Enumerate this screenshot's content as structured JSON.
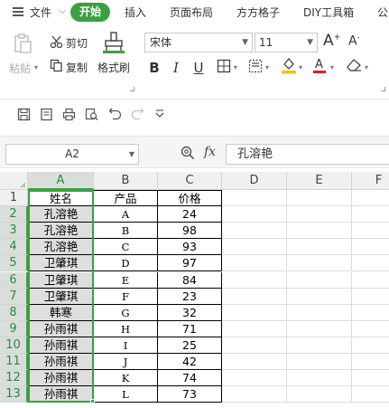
{
  "menu": {
    "items": [
      {
        "label": "文件"
      },
      {
        "label": "开始"
      },
      {
        "label": "插入"
      },
      {
        "label": "页面布局"
      },
      {
        "label": "方方格子"
      },
      {
        "label": "DIY工具箱"
      },
      {
        "label": "公"
      }
    ]
  },
  "ribbon": {
    "paste_label": "粘贴",
    "cut_label": "剪切",
    "copy_label": "复制",
    "format_painter_label": "格式刷",
    "font_name": "宋体",
    "font_size": "11",
    "font_color": "#e02020",
    "highlight_color": "#f3c300"
  },
  "formula_bar": {
    "name_box": "A2",
    "fx_label": "fx",
    "content": "孔溶艳"
  },
  "sheet": {
    "columns": [
      "A",
      "B",
      "C",
      "D",
      "E",
      "F"
    ],
    "rows": [
      "1",
      "2",
      "3",
      "4",
      "5",
      "6",
      "7",
      "8",
      "9",
      "10",
      "11",
      "12",
      "13"
    ],
    "selected_cell": "A2",
    "header": [
      "姓名",
      "产品",
      "价格"
    ],
    "data": [
      [
        "孔溶艳",
        "A",
        "24"
      ],
      [
        "孔溶艳",
        "B",
        "98"
      ],
      [
        "孔溶艳",
        "C",
        "93"
      ],
      [
        "卫肇琪",
        "D",
        "97"
      ],
      [
        "卫肇琪",
        "E",
        "84"
      ],
      [
        "卫肇琪",
        "F",
        "23"
      ],
      [
        "韩寒",
        "G",
        "32"
      ],
      [
        "孙雨祺",
        "H",
        "71"
      ],
      [
        "孙雨祺",
        "I",
        "25"
      ],
      [
        "孙雨祺",
        "J",
        "42"
      ],
      [
        "孙雨祺",
        "K",
        "74"
      ],
      [
        "孙雨祺",
        "L",
        "73"
      ]
    ],
    "accent_color": "#3aa040"
  }
}
